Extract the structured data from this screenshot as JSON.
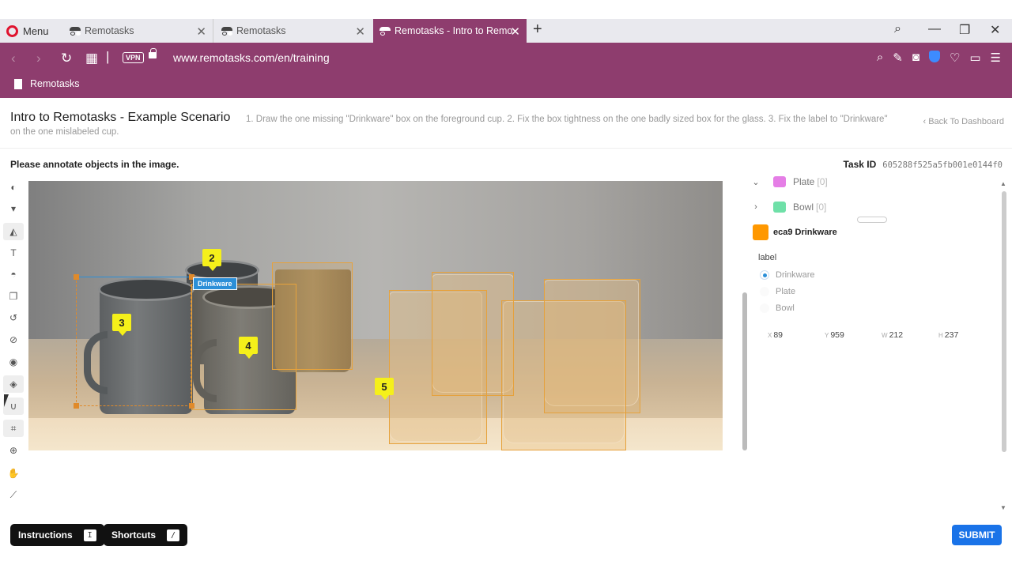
{
  "browser": {
    "menu_label": "Menu",
    "tabs": [
      {
        "title": "Remotasks"
      },
      {
        "title": "Remotasks"
      },
      {
        "title": "Remotasks - Intro to Remo"
      }
    ],
    "vpn_label": "VPN",
    "url": "www.remotasks.com/en/training",
    "bookmark": "Remotasks",
    "accent_color": "#8e3d6e"
  },
  "header": {
    "title": "Intro to Remotasks - Example Scenario",
    "instructions": "1. Draw the one missing \"Drinkware\" box on the foreground cup. 2. Fix the box tightness on the one badly sized box for the glass. 3. Fix the label to \"Drinkware\" on the one mislabeled cup.",
    "back_label": "Back To Dashboard"
  },
  "task": {
    "prompt": "Please annotate objects in the image.",
    "id_label": "Task ID",
    "id_value": "605288f525a5fb001e0144f0"
  },
  "canvas": {
    "selected_label": "Drinkware",
    "markers": [
      "2",
      "3",
      "4",
      "5"
    ]
  },
  "panel": {
    "classes": [
      {
        "name": "Plate",
        "count": "[0]",
        "color": "#e57ee6",
        "expanded": true
      },
      {
        "name": "Bowl",
        "count": "[0]",
        "color": "#6fe0a8",
        "expanded": false
      }
    ],
    "selected_annotation": "eca9 Drinkware",
    "label_title": "label",
    "label_options": [
      "Drinkware",
      "Plate",
      "Bowl"
    ],
    "selected_option": "Drinkware",
    "x": "89",
    "y": "959",
    "w": "212",
    "h": "237"
  },
  "footer": {
    "instructions_label": "Instructions",
    "instructions_key": "I",
    "shortcuts_label": "Shortcuts",
    "shortcuts_key": "/",
    "submit_label": "SUBMIT",
    "submit_color": "#1a73e8"
  }
}
